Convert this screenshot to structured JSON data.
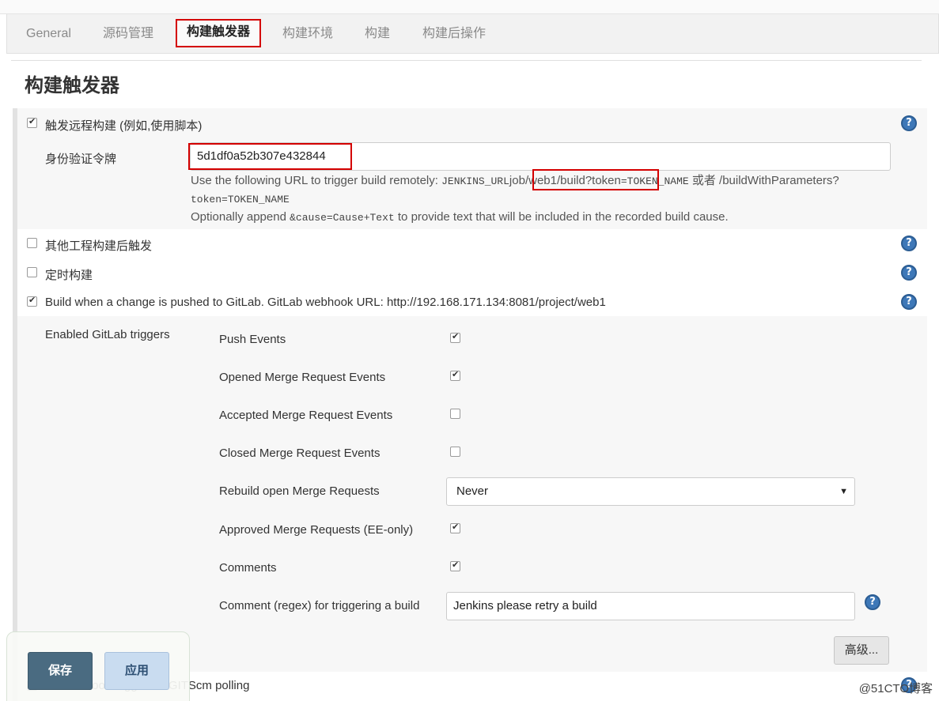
{
  "tabs": [
    {
      "label": "General"
    },
    {
      "label": "源码管理"
    },
    {
      "label": "构建触发器"
    },
    {
      "label": "构建环境"
    },
    {
      "label": "构建"
    },
    {
      "label": "构建后操作"
    }
  ],
  "section_title": "构建触发器",
  "triggers": {
    "remote": {
      "label": "触发远程构建 (例如,使用脚本)",
      "checked": true,
      "token_label": "身份验证令牌",
      "token_value": "5d1df0a52b307e432844",
      "desc_prefix": "Use the following URL to trigger build remotely: ",
      "desc_jenkins_url": "JENKINS_URL",
      "desc_job_path": "job/web1/build?token",
      "desc_token_name": "=TOKEN_NAME",
      "desc_or": " 或者 /buildWithParameters?",
      "desc_line2": "token=TOKEN_NAME",
      "desc_append_prefix": "Optionally append ",
      "desc_append_code": "&cause=Cause+Text",
      "desc_append_suffix": " to provide text that will be included in the recorded build cause."
    },
    "after_other": {
      "label": "其他工程构建后触发",
      "checked": false
    },
    "periodic": {
      "label": "定时构建",
      "checked": false
    },
    "gitlab": {
      "label": "Build when a change is pushed to GitLab. GitLab webhook URL: http://192.168.171.134:8081/project/web1",
      "checked": true,
      "enabled_label": "Enabled GitLab triggers",
      "push_events": {
        "label": "Push Events",
        "checked": true
      },
      "opened_mr": {
        "label": "Opened Merge Request Events",
        "checked": true
      },
      "accepted_mr": {
        "label": "Accepted Merge Request Events",
        "checked": false
      },
      "closed_mr": {
        "label": "Closed Merge Request Events",
        "checked": false
      },
      "rebuild_open_mr": {
        "label": "Rebuild open Merge Requests",
        "value": "Never"
      },
      "approved_mr": {
        "label": "Approved Merge Requests (EE-only)",
        "checked": true
      },
      "comments": {
        "label": "Comments",
        "checked": true
      },
      "comment_regex": {
        "label": "Comment (regex) for triggering a build",
        "value": "Jenkins please retry a build"
      },
      "advanced_label": "高级..."
    },
    "gitscm": {
      "label": "GitHub hook trigger for GITScm polling"
    }
  },
  "footer": {
    "save_label": "保存",
    "apply_label": "应用"
  },
  "watermark": "@51CTO博客",
  "help_glyph": "?"
}
